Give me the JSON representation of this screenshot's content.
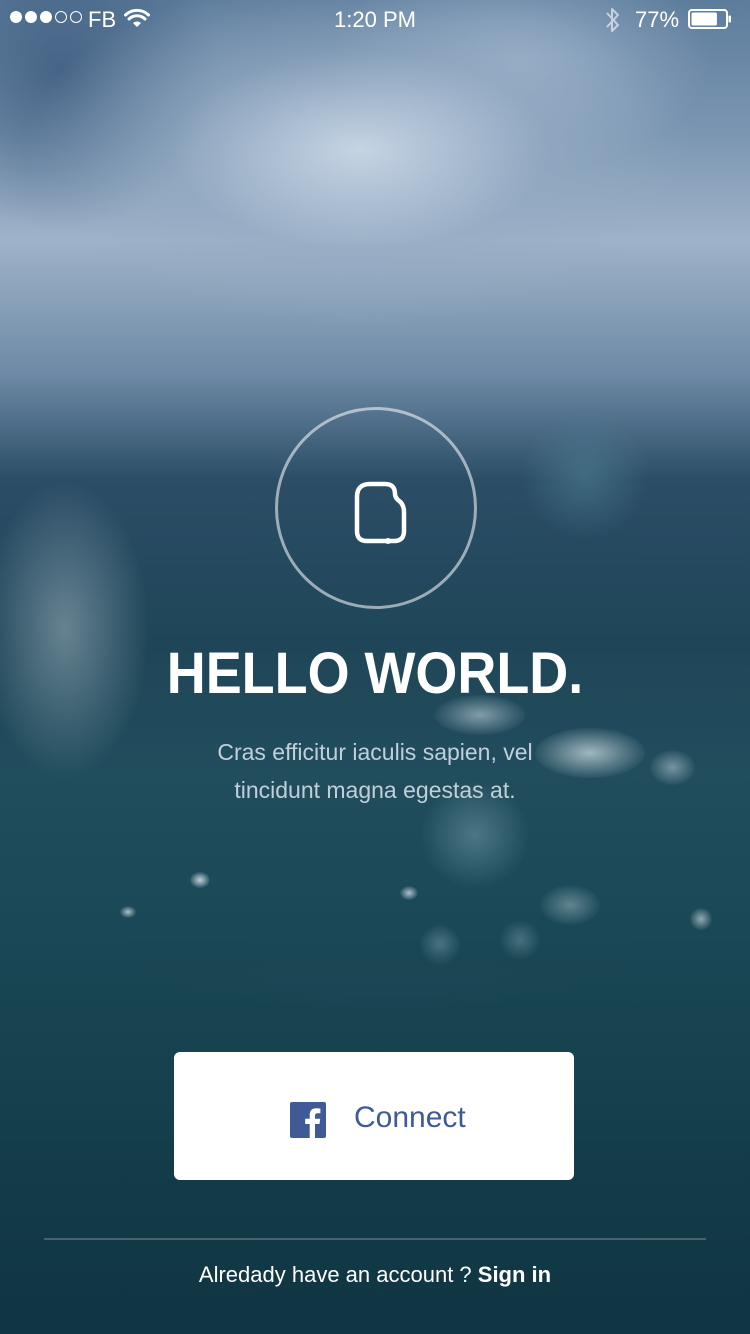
{
  "status_bar": {
    "carrier": "FB",
    "time": "1:20 PM",
    "battery_percent": "77%",
    "battery_level": 0.77,
    "signal_bars_filled": 3,
    "signal_bars_total": 5
  },
  "hero": {
    "logo_icon": "document-icon",
    "title": "HELLO WORLD.",
    "subtitle": "Cras efficitur iaculis sapien, vel tincidunt magna egestas at."
  },
  "connect_button": {
    "label": "Connect",
    "icon": "facebook-icon",
    "label_color": "#3f5a96",
    "icon_color": "#3f5a96"
  },
  "footer": {
    "prompt": "Alredady have an account ?",
    "sign_in_label": "Sign in"
  }
}
